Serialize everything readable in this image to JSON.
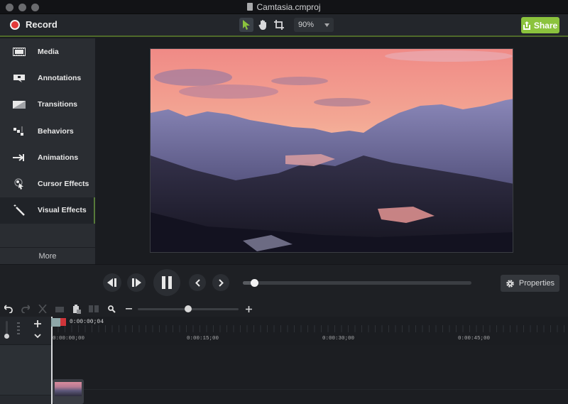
{
  "window": {
    "title": "Camtasia.cmproj",
    "traffic_lights": [
      "close",
      "minimize",
      "zoom"
    ]
  },
  "toolbar": {
    "record_label": "Record",
    "tools": [
      {
        "name": "select-tool",
        "icon": "arrow-pointer-icon",
        "active": true
      },
      {
        "name": "pan-tool",
        "icon": "hand-icon",
        "active": false
      },
      {
        "name": "crop-tool",
        "icon": "crop-icon",
        "active": false
      }
    ],
    "zoom_level": "90%",
    "share_label": "Share",
    "colors": {
      "accent": "#8bc33d",
      "record": "#e33a3a"
    }
  },
  "sidebar": {
    "items": [
      {
        "label": "Media",
        "icon": "film-strip-icon",
        "active": false
      },
      {
        "label": "Annotations",
        "icon": "callout-icon",
        "active": false
      },
      {
        "label": "Transitions",
        "icon": "transition-icon",
        "active": false
      },
      {
        "label": "Behaviors",
        "icon": "behaviors-icon",
        "active": false
      },
      {
        "label": "Animations",
        "icon": "arrow-right-icon",
        "active": false
      },
      {
        "label": "Cursor Effects",
        "icon": "cursor-effect-icon",
        "active": false
      },
      {
        "label": "Visual Effects",
        "icon": "magic-wand-icon",
        "active": true
      }
    ],
    "more_label": "More"
  },
  "canvas": {
    "preview_description": "Mountain valley at sunset with pink sky and frozen lakes"
  },
  "playback": {
    "buttons": [
      "step-back",
      "step-forward",
      "pause",
      "previous",
      "next"
    ],
    "scrub_progress": 0.05,
    "properties_label": "Properties"
  },
  "timeline": {
    "tools": [
      "undo",
      "redo",
      "cut",
      "copy",
      "paste",
      "split",
      "zoom"
    ],
    "zoom_slider": 0.5,
    "playhead_time": "0:00:00;04",
    "ruler_labels": [
      "0:00:00;00",
      "0:00:15;00",
      "0:00:30;00",
      "0:00:45;00"
    ]
  }
}
